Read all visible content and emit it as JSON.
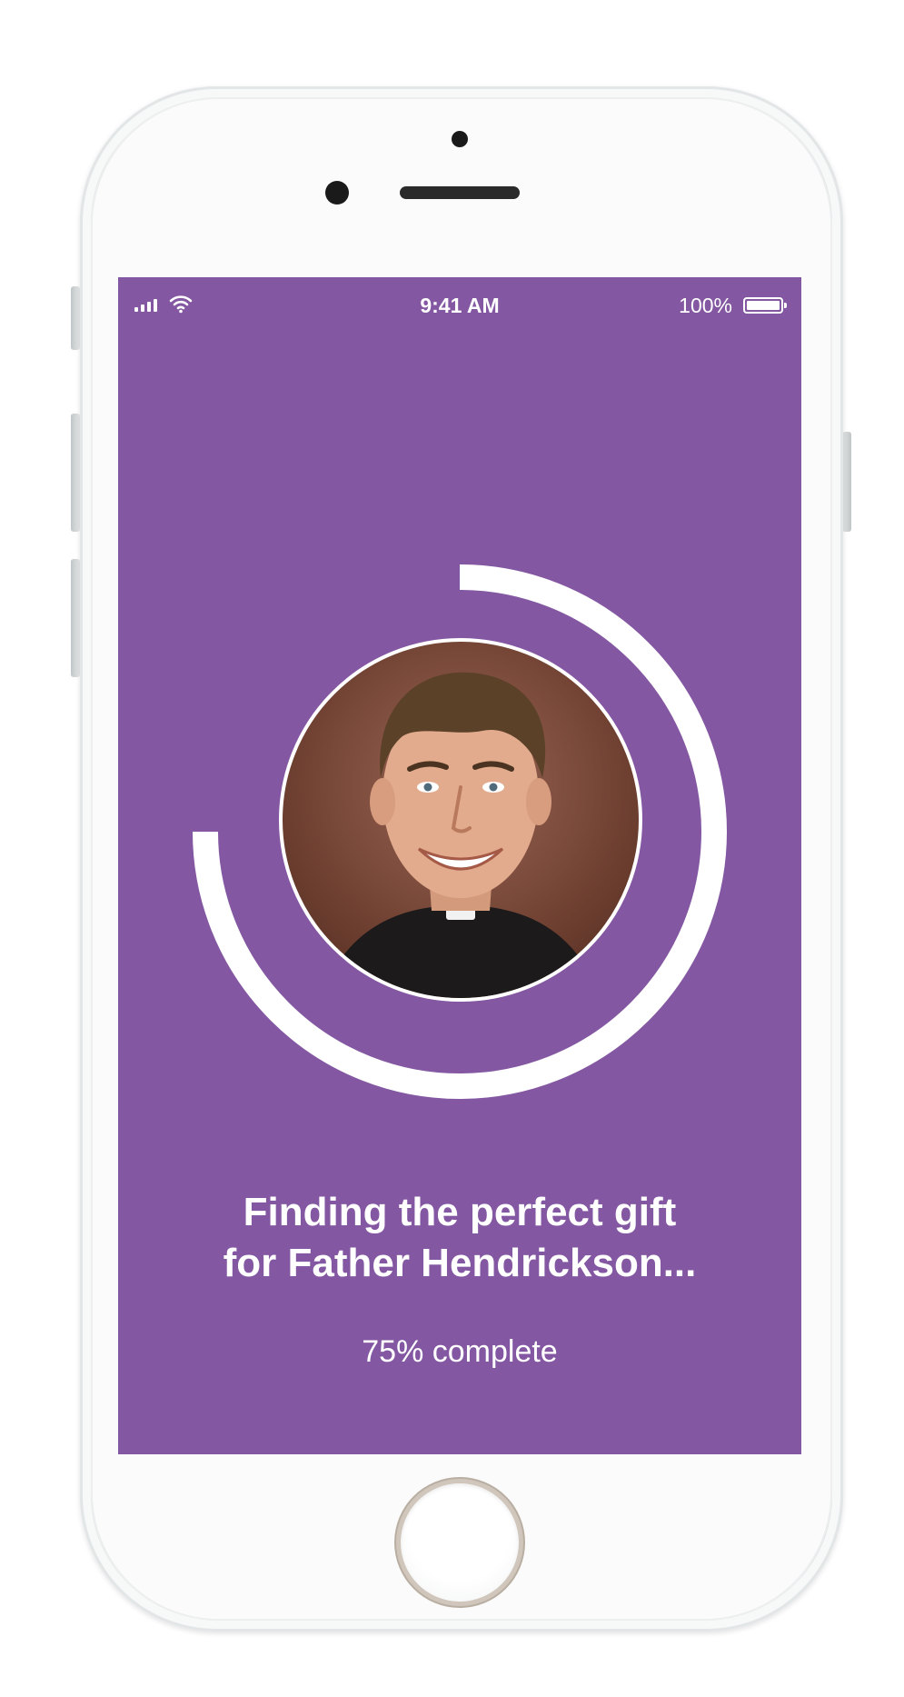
{
  "status_bar": {
    "time": "9:41 AM",
    "battery": "100%",
    "signal_icon": "cellular-signal-icon",
    "wifi_icon": "wifi-icon",
    "battery_icon": "battery-full-icon"
  },
  "loading": {
    "headline": "Finding the perfect gift\nfor Father Hendrickson...",
    "progress_text": "75% complete",
    "progress_fraction": 0.75,
    "avatar_icon": "person-portrait-icon"
  },
  "colors": {
    "screen_background": "#8357a2",
    "accent": "#ffffff"
  }
}
